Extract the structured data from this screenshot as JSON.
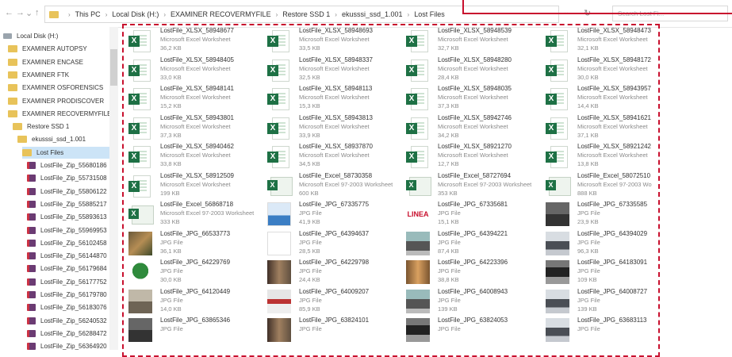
{
  "address_bar": {
    "nav_glyphs": [
      "←",
      "→",
      "⌄",
      "↑"
    ],
    "breadcrumb": [
      "This PC",
      "Local Disk (H:)",
      "EXAMINER RECOVERMYFILE",
      "Restore SSD 1",
      "ekusssi_ssd_1.001",
      "Lost Files"
    ],
    "separator": "›",
    "dropdown_glyph": "⌄",
    "refresh_glyph": "↻",
    "search_placeholder": "Search Lost Fi..."
  },
  "sidebar": {
    "items": [
      {
        "label": "Local Disk (H:)",
        "icon": "drive-icon",
        "indent": 0
      },
      {
        "label": "EXAMINER AUTOPSY",
        "icon": "folder-icon",
        "indent": 1
      },
      {
        "label": "EXAMINER ENCASE",
        "icon": "folder-icon",
        "indent": 1
      },
      {
        "label": "EXAMINER FTK",
        "icon": "folder-icon",
        "indent": 1
      },
      {
        "label": "EXAMINER OSFORENSICS",
        "icon": "folder-icon",
        "indent": 1
      },
      {
        "label": "EXAMINER PRODISCOVER",
        "icon": "folder-icon",
        "indent": 1
      },
      {
        "label": "EXAMINER RECOVERMYFILE",
        "icon": "folder-icon",
        "indent": 1
      },
      {
        "label": "Restore SSD 1",
        "icon": "folder-icon",
        "indent": 2
      },
      {
        "label": "ekusssi_ssd_1.001",
        "icon": "folder-icon",
        "indent": 3
      },
      {
        "label": "Lost Files",
        "icon": "folder-icon",
        "indent": 4,
        "selected": true
      },
      {
        "label": "LostFile_Zip_55680186",
        "icon": "zip-icon",
        "indent": 5
      },
      {
        "label": "LostFile_Zip_55731508",
        "icon": "zip-icon",
        "indent": 5
      },
      {
        "label": "LostFile_Zip_55806122",
        "icon": "zip-icon",
        "indent": 5
      },
      {
        "label": "LostFile_Zip_55885217",
        "icon": "zip-icon",
        "indent": 5
      },
      {
        "label": "LostFile_Zip_55893613",
        "icon": "zip-icon",
        "indent": 5
      },
      {
        "label": "LostFile_Zip_55969953",
        "icon": "zip-icon",
        "indent": 5
      },
      {
        "label": "LostFile_Zip_56102458",
        "icon": "zip-icon",
        "indent": 5
      },
      {
        "label": "LostFile_Zip_56144870",
        "icon": "zip-icon",
        "indent": 5
      },
      {
        "label": "LostFile_Zip_56179684",
        "icon": "zip-icon",
        "indent": 5
      },
      {
        "label": "LostFile_Zip_56177752",
        "icon": "zip-icon",
        "indent": 5
      },
      {
        "label": "LostFile_Zip_56179780",
        "icon": "zip-icon",
        "indent": 5
      },
      {
        "label": "LostFile_Zip_56183076",
        "icon": "zip-icon",
        "indent": 5
      },
      {
        "label": "LostFile_Zip_56240532",
        "icon": "zip-icon",
        "indent": 5
      },
      {
        "label": "LostFile_Zip_56288472",
        "icon": "zip-icon",
        "indent": 5
      },
      {
        "label": "LostFile_Zip_56364920",
        "icon": "zip-icon",
        "indent": 5
      }
    ]
  },
  "files": [
    {
      "name": "LostFile_XLSX_58948677",
      "type": "Microsoft Excel Worksheet",
      "size": "36,2 KB",
      "thumb": "xlsx"
    },
    {
      "name": "LostFile_XLSX_58948693",
      "type": "Microsoft Excel Worksheet",
      "size": "33,5 KB",
      "thumb": "xlsx"
    },
    {
      "name": "LostFile_XLSX_58948539",
      "type": "Microsoft Excel Worksheet",
      "size": "32,7 KB",
      "thumb": "xlsx"
    },
    {
      "name": "LostFile_XLSX_58948473",
      "type": "Microsoft Excel Worksheet",
      "size": "32,1 KB",
      "thumb": "xlsx"
    },
    {
      "name": "LostFile_XLSX_58948405",
      "type": "Microsoft Excel Worksheet",
      "size": "33,0 KB",
      "thumb": "xlsx"
    },
    {
      "name": "LostFile_XLSX_58948337",
      "type": "Microsoft Excel Worksheet",
      "size": "32,5 KB",
      "thumb": "xlsx"
    },
    {
      "name": "LostFile_XLSX_58948280",
      "type": "Microsoft Excel Worksheet",
      "size": "28,4 KB",
      "thumb": "xlsx"
    },
    {
      "name": "LostFile_XLSX_58948172",
      "type": "Microsoft Excel Worksheet",
      "size": "30,0 KB",
      "thumb": "xlsx"
    },
    {
      "name": "LostFile_XLSX_58948141",
      "type": "Microsoft Excel Worksheet",
      "size": "15,2 KB",
      "thumb": "xlsx"
    },
    {
      "name": "LostFile_XLSX_58948113",
      "type": "Microsoft Excel Worksheet",
      "size": "15,3 KB",
      "thumb": "xlsx"
    },
    {
      "name": "LostFile_XLSX_58948035",
      "type": "Microsoft Excel Worksheet",
      "size": "37,3 KB",
      "thumb": "xlsx"
    },
    {
      "name": "LostFile_XLSX_58943957",
      "type": "Microsoft Excel Worksheet",
      "size": "14,4 KB",
      "thumb": "xlsx"
    },
    {
      "name": "LostFile_XLSX_58943801",
      "type": "Microsoft Excel Worksheet",
      "size": "37,3 KB",
      "thumb": "xlsx"
    },
    {
      "name": "LostFile_XLSX_58943813",
      "type": "Microsoft Excel Worksheet",
      "size": "33,9 KB",
      "thumb": "xlsx"
    },
    {
      "name": "LostFile_XLSX_58942746",
      "type": "Microsoft Excel Worksheet",
      "size": "34,2 KB",
      "thumb": "xlsx"
    },
    {
      "name": "LostFile_XLSX_58941621",
      "type": "Microsoft Excel Worksheet",
      "size": "37,1 KB",
      "thumb": "xlsx"
    },
    {
      "name": "LostFile_XLSX_58940462",
      "type": "Microsoft Excel Worksheet",
      "size": "33,8 KB",
      "thumb": "xlsx"
    },
    {
      "name": "LostFile_XLSX_58937870",
      "type": "Microsoft Excel Worksheet",
      "size": "34,5 KB",
      "thumb": "xlsx"
    },
    {
      "name": "LostFile_XLSX_58921270",
      "type": "Microsoft Excel Worksheet",
      "size": "12,7 KB",
      "thumb": "xlsx"
    },
    {
      "name": "LostFile_XLSX_58921242",
      "type": "Microsoft Excel Worksheet",
      "size": "13,8 KB",
      "thumb": "xlsx"
    },
    {
      "name": "LostFile_XLSX_58912509",
      "type": "Microsoft Excel Worksheet",
      "size": "199 KB",
      "thumb": "xlsx"
    },
    {
      "name": "LostFile_Excel_58730358",
      "type": "Microsoft Excel 97-2003 Worksheet",
      "size": "600 KB",
      "thumb": "xls"
    },
    {
      "name": "LostFile_Excel_58727694",
      "type": "Microsoft Excel 97-2003 Worksheet",
      "size": "353 KB",
      "thumb": "xls"
    },
    {
      "name": "LostFile_Excel_58072510",
      "type": "Microsoft Excel 97-2003 Wo",
      "size": "888 KB",
      "thumb": "xls"
    },
    {
      "name": "LostFile_Excel_56868718",
      "type": "Microsoft Excel 97-2003 Worksheet",
      "size": "333 KB",
      "thumb": "xls"
    },
    {
      "name": "LostFile_JPG_67335775",
      "type": "JPG File",
      "size": "41,9 KB",
      "thumb": "img-mtn"
    },
    {
      "name": "LostFile_JPG_67335681",
      "type": "JPG File",
      "size": "15,1 KB",
      "thumb": "img-logo",
      "logo": "LINEA"
    },
    {
      "name": "LostFile_JPG_67335585",
      "type": "JPG File",
      "size": "23,9 KB",
      "thumb": "photo-j"
    },
    {
      "name": "LostFile_JPG_66533773",
      "type": "JPG File",
      "size": "36,1 KB",
      "thumb": "photo-b"
    },
    {
      "name": "LostFile_JPG_64394637",
      "type": "JPG File",
      "size": "28,5 KB",
      "thumb": "img-blank"
    },
    {
      "name": "LostFile_JPG_64394221",
      "type": "JPG File",
      "size": "87,4 KB",
      "thumb": "photo-c"
    },
    {
      "name": "LostFile_JPG_64394029",
      "type": "JPG File",
      "size": "96,3 KB",
      "thumb": "photo-e"
    },
    {
      "name": "LostFile_JPG_64229769",
      "type": "JPG File",
      "size": "30,0 KB",
      "thumb": "photo-f"
    },
    {
      "name": "LostFile_JPG_64229798",
      "type": "JPG File",
      "size": "24,4 KB",
      "thumb": "photo-d"
    },
    {
      "name": "LostFile_JPG_64223396",
      "type": "JPG File",
      "size": "38,8 KB",
      "thumb": "photo-i"
    },
    {
      "name": "LostFile_JPG_64183091",
      "type": "JPG File",
      "size": "109 KB",
      "thumb": "photo-a"
    },
    {
      "name": "LostFile_JPG_64120449",
      "type": "JPG File",
      "size": "14,0 KB",
      "thumb": "photo-g"
    },
    {
      "name": "LostFile_JPG_64009207",
      "type": "JPG File",
      "size": "85,9 KB",
      "thumb": "photo-h"
    },
    {
      "name": "LostFile_JPG_64008943",
      "type": "JPG File",
      "size": "139 KB",
      "thumb": "photo-c"
    },
    {
      "name": "LostFile_JPG_64008727",
      "type": "JPG File",
      "size": "139 KB",
      "thumb": "photo-e"
    },
    {
      "name": "LostFile_JPG_63865346",
      "type": "JPG File",
      "size": "",
      "thumb": "photo-j"
    },
    {
      "name": "LostFile_JPG_63824101",
      "type": "JPG File",
      "size": "",
      "thumb": "photo-d"
    },
    {
      "name": "LostFile_JPG_63824053",
      "type": "JPG File",
      "size": "",
      "thumb": "photo-a"
    },
    {
      "name": "LostFile_JPG_63683113",
      "type": "JPG File",
      "size": "",
      "thumb": "photo-e"
    }
  ],
  "colors": {
    "highlight_border": "#c8102e",
    "excel_green": "#1e7145",
    "selection": "#cce4f7"
  }
}
